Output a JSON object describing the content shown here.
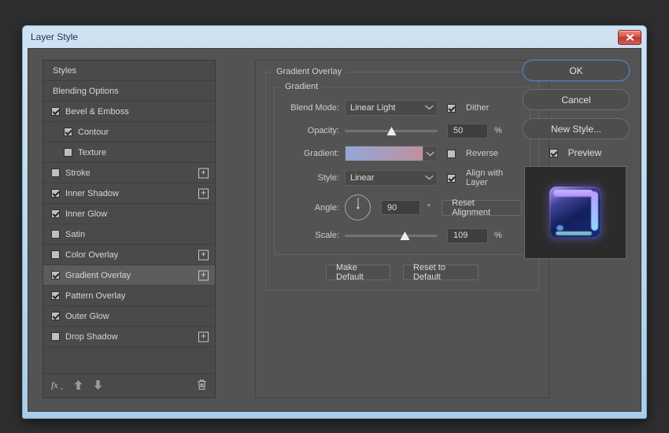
{
  "window": {
    "title": "Layer Style",
    "close_icon": "close-x-icon"
  },
  "styles_panel": {
    "items": [
      {
        "label": "Styles",
        "has_checkbox": false,
        "checked": false,
        "indent": false,
        "plus": false,
        "selected": false
      },
      {
        "label": "Blending Options",
        "has_checkbox": false,
        "checked": false,
        "indent": false,
        "plus": false,
        "selected": false
      },
      {
        "label": "Bevel & Emboss",
        "has_checkbox": true,
        "checked": true,
        "indent": false,
        "plus": false,
        "selected": false
      },
      {
        "label": "Contour",
        "has_checkbox": true,
        "checked": true,
        "indent": true,
        "plus": false,
        "selected": false
      },
      {
        "label": "Texture",
        "has_checkbox": true,
        "checked": false,
        "indent": true,
        "plus": false,
        "selected": false
      },
      {
        "label": "Stroke",
        "has_checkbox": true,
        "checked": false,
        "indent": false,
        "plus": true,
        "selected": false
      },
      {
        "label": "Inner Shadow",
        "has_checkbox": true,
        "checked": true,
        "indent": false,
        "plus": true,
        "selected": false
      },
      {
        "label": "Inner Glow",
        "has_checkbox": true,
        "checked": true,
        "indent": false,
        "plus": false,
        "selected": false
      },
      {
        "label": "Satin",
        "has_checkbox": true,
        "checked": false,
        "indent": false,
        "plus": false,
        "selected": false
      },
      {
        "label": "Color Overlay",
        "has_checkbox": true,
        "checked": false,
        "indent": false,
        "plus": true,
        "selected": false
      },
      {
        "label": "Gradient Overlay",
        "has_checkbox": true,
        "checked": true,
        "indent": false,
        "plus": true,
        "selected": true
      },
      {
        "label": "Pattern Overlay",
        "has_checkbox": true,
        "checked": true,
        "indent": false,
        "plus": false,
        "selected": false
      },
      {
        "label": "Outer Glow",
        "has_checkbox": true,
        "checked": true,
        "indent": false,
        "plus": false,
        "selected": false
      },
      {
        "label": "Drop Shadow",
        "has_checkbox": true,
        "checked": false,
        "indent": false,
        "plus": true,
        "selected": false
      }
    ],
    "footer": {
      "fx_icon": "fx-icon",
      "move_up_icon": "arrow-up-icon",
      "move_down_icon": "arrow-down-icon",
      "delete_icon": "trash-icon"
    }
  },
  "gradient_overlay": {
    "group_legend": "Gradient Overlay",
    "inner_legend": "Gradient",
    "blend_mode": {
      "label": "Blend Mode:",
      "value": "Linear Light"
    },
    "dither": {
      "label": "Dither",
      "checked": true
    },
    "opacity": {
      "label": "Opacity:",
      "value": "50",
      "unit": "%",
      "percent": 50
    },
    "gradient": {
      "label": "Gradient:",
      "start_color": "#94a7d8",
      "end_color": "#c08fa0"
    },
    "reverse": {
      "label": "Reverse",
      "checked": false
    },
    "style": {
      "label": "Style:",
      "value": "Linear"
    },
    "align": {
      "label": "Align with Layer",
      "checked": true
    },
    "angle": {
      "label": "Angle:",
      "value": "90",
      "unit": "°",
      "degrees": 90
    },
    "reset_alignment_label": "Reset Alignment",
    "scale": {
      "label": "Scale:",
      "value": "109",
      "unit": "%",
      "percent": 64
    },
    "make_default_label": "Make Default",
    "reset_to_default_label": "Reset to Default"
  },
  "actions": {
    "ok_label": "OK",
    "cancel_label": "Cancel",
    "new_style_label": "New Style...",
    "preview": {
      "label": "Preview",
      "checked": true
    }
  },
  "theme": {
    "accent": "#4a7fbf",
    "panel_bg": "#535353",
    "list_bg": "#4a4a4a",
    "titlebar": "#bcd8ef"
  }
}
